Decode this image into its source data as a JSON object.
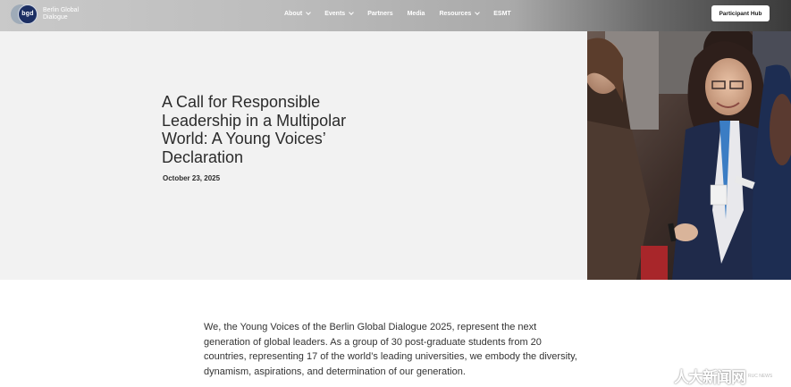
{
  "header": {
    "logo_text": "Berlin Global Dialogue",
    "logo_mark": "bgd",
    "nav": [
      {
        "label": "About",
        "dropdown": true
      },
      {
        "label": "Events",
        "dropdown": true
      },
      {
        "label": "Partners",
        "dropdown": false
      },
      {
        "label": "Media",
        "dropdown": false
      },
      {
        "label": "Resources",
        "dropdown": true
      },
      {
        "label": "ESMT",
        "dropdown": false
      }
    ],
    "hub_label": "Participant Hub"
  },
  "hero": {
    "title": "A Call for Responsible Leadership in a Multipolar World: A Young Voices’ Declaration",
    "date": "October 23, 2025"
  },
  "article": {
    "intro": "We, the Young Voices of the Berlin Global Dialogue 2025, represent the next generation of global leaders. As a group of 30 post-graduate students from 20 countries, representing 17 of the world’s leading universities, we embody the diversity, dynamism, aspirations, and determination of our generation."
  },
  "watermark": {
    "text": "人大新闻网",
    "small": "RUC NEWS"
  },
  "colors": {
    "hero_bg": "#f2f2f2",
    "logo_blue": "#1c2f63",
    "text": "#2b2b2b"
  }
}
